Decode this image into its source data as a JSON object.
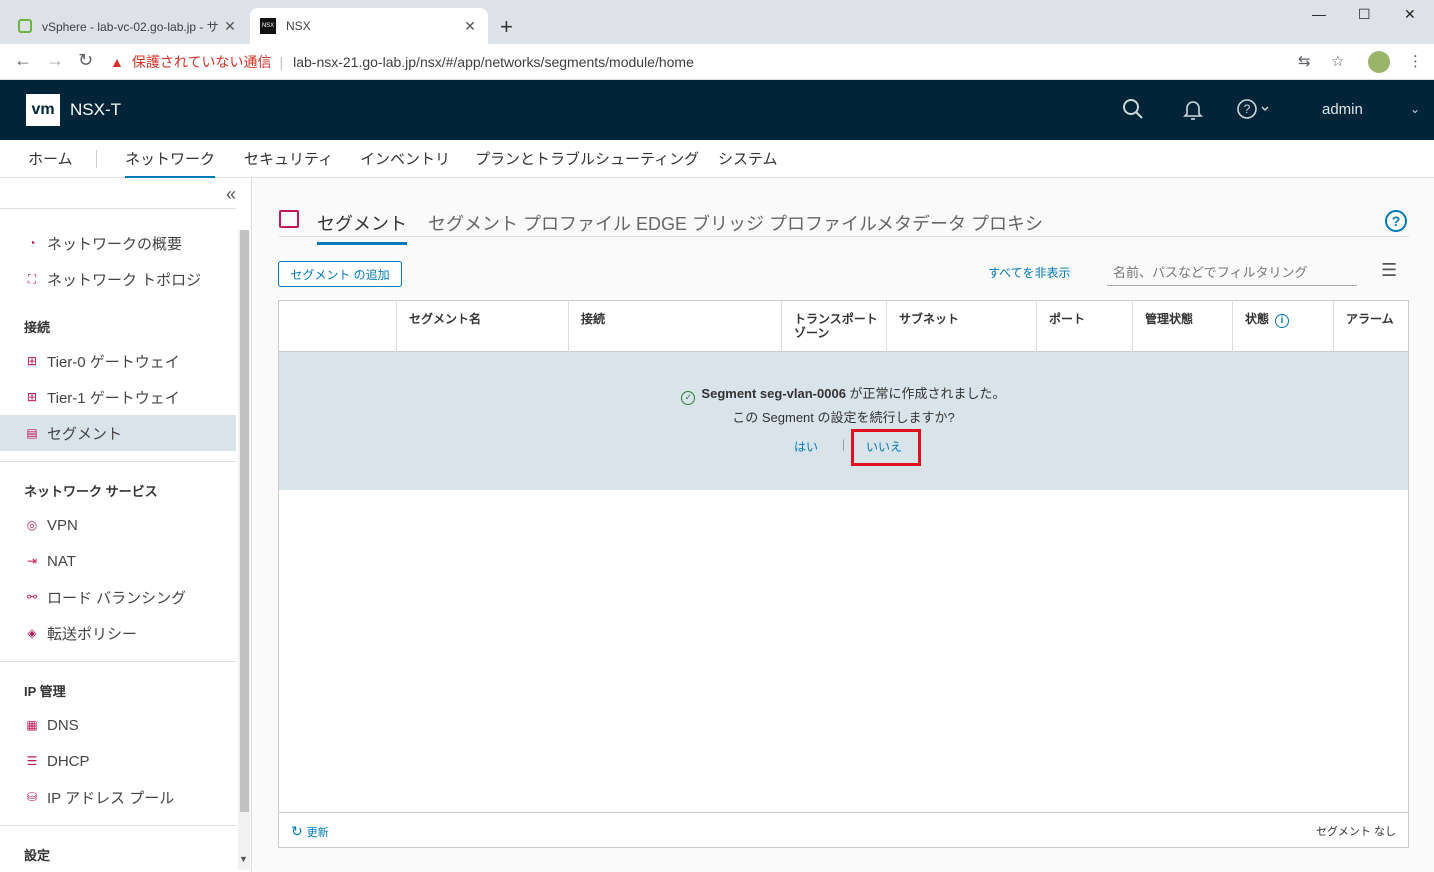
{
  "browser": {
    "tabs": [
      {
        "title": "vSphere - lab-vc-02.go-lab.jp - サ",
        "active": false
      },
      {
        "title": "NSX",
        "active": true,
        "favicon_text": "NSX"
      }
    ],
    "security_label": "保護されていない通信",
    "url": "lab-nsx-21.go-lab.jp/nsx/#/app/networks/segments/module/home"
  },
  "header": {
    "logo": "vm",
    "product": "NSX-T",
    "user": "admin"
  },
  "topnav": {
    "items": [
      "ホーム",
      "ネットワーク",
      "セキュリティ",
      "インベントリ",
      "プランとトラブルシューティング",
      "システム"
    ],
    "active": "ネットワーク"
  },
  "sidebar": {
    "top_items": [
      "ネットワークの概要",
      "ネットワーク トポロジ"
    ],
    "sections": [
      {
        "heading": "接続",
        "items": [
          "Tier-0 ゲートウェイ",
          "Tier-1 ゲートウェイ",
          "セグメント"
        ]
      },
      {
        "heading": "ネットワーク サービス",
        "items": [
          "VPN",
          "NAT",
          "ロード バランシング",
          "転送ポリシー"
        ]
      },
      {
        "heading": "IP 管理",
        "items": [
          "DNS",
          "DHCP",
          "IP アドレス プール"
        ]
      },
      {
        "heading": "設定",
        "items": []
      }
    ],
    "active_item": "セグメント"
  },
  "content": {
    "tabs": [
      "セグメント",
      "セグメント プロファイル",
      "EDGE ブリッジ プロファイル",
      "メタデータ プロキシ"
    ],
    "active_tab": "セグメント",
    "add_button": "セグメント の追加",
    "hide_all": "すべてを非表示",
    "filter_placeholder": "名前、パスなどでフィルタリング",
    "columns": [
      "セグメント名",
      "接続",
      "トランスポート ゾーン",
      "サブネット",
      "ポート",
      "管理状態",
      "状態",
      "アラーム"
    ],
    "banner": {
      "success_segment": "Segment seg-vlan-0006",
      "success_suffix": " が正常に作成されました。",
      "question": "この Segment の設定を続行しますか?",
      "yes": "はい",
      "separator": "|",
      "no": "いいえ"
    },
    "footer": {
      "refresh": "更新",
      "count": "セグメント なし"
    }
  },
  "colors": {
    "header_bg": "#002538",
    "accent": "#0079b8",
    "banner_bg": "#d9e4ea",
    "highlight_box": "#e0101c"
  }
}
